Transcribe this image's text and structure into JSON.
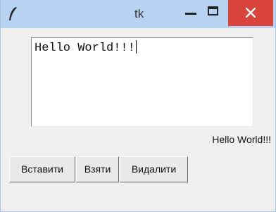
{
  "window": {
    "title": "tk",
    "app_icon": "feather-icon",
    "controls": {
      "minimize_icon": "minimize-icon",
      "maximize_icon": "maximize-icon",
      "close_icon": "close-icon",
      "close_color": "#d9443b"
    },
    "titlebar_color": "#b7d3f1"
  },
  "text_widget": {
    "content": "Hello World!!!"
  },
  "label": {
    "text": "Hello World!!!"
  },
  "buttons": {
    "insert_label": "Вставити",
    "take_label": "Взяти",
    "delete_label": "Видалити"
  }
}
